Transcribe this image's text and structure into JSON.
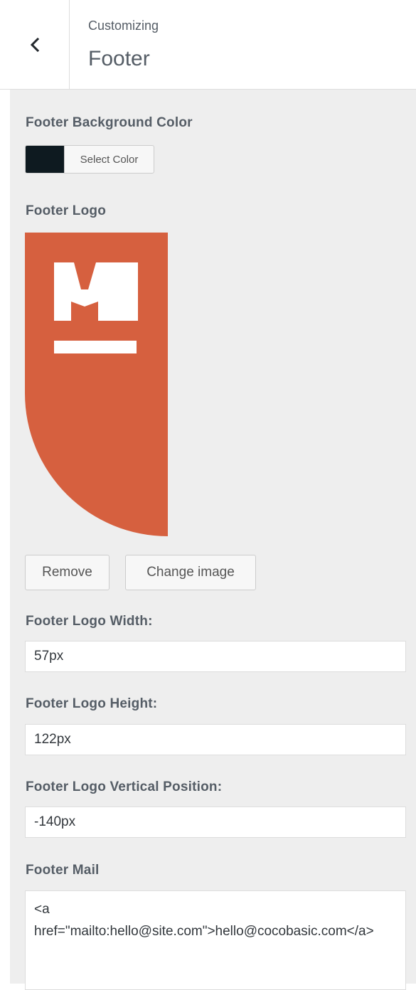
{
  "header": {
    "subtitle": "Customizing",
    "title": "Footer"
  },
  "bg_color": {
    "label": "Footer Background Color",
    "button_label": "Select Color",
    "swatch_color": "#0e1a20"
  },
  "logo": {
    "label": "Footer Logo",
    "accent_color": "#d6603f",
    "remove_label": "Remove",
    "change_label": "Change image"
  },
  "logo_width": {
    "label": "Footer Logo Width:",
    "value": "57px"
  },
  "logo_height": {
    "label": "Footer Logo Height:",
    "value": "122px"
  },
  "logo_vpos": {
    "label": "Footer Logo Vertical Position:",
    "value": "-140px"
  },
  "mail": {
    "label": "Footer Mail",
    "value": "<a\nhref=\"mailto:hello@site.com\">hello@cocobasic.com</a>"
  }
}
